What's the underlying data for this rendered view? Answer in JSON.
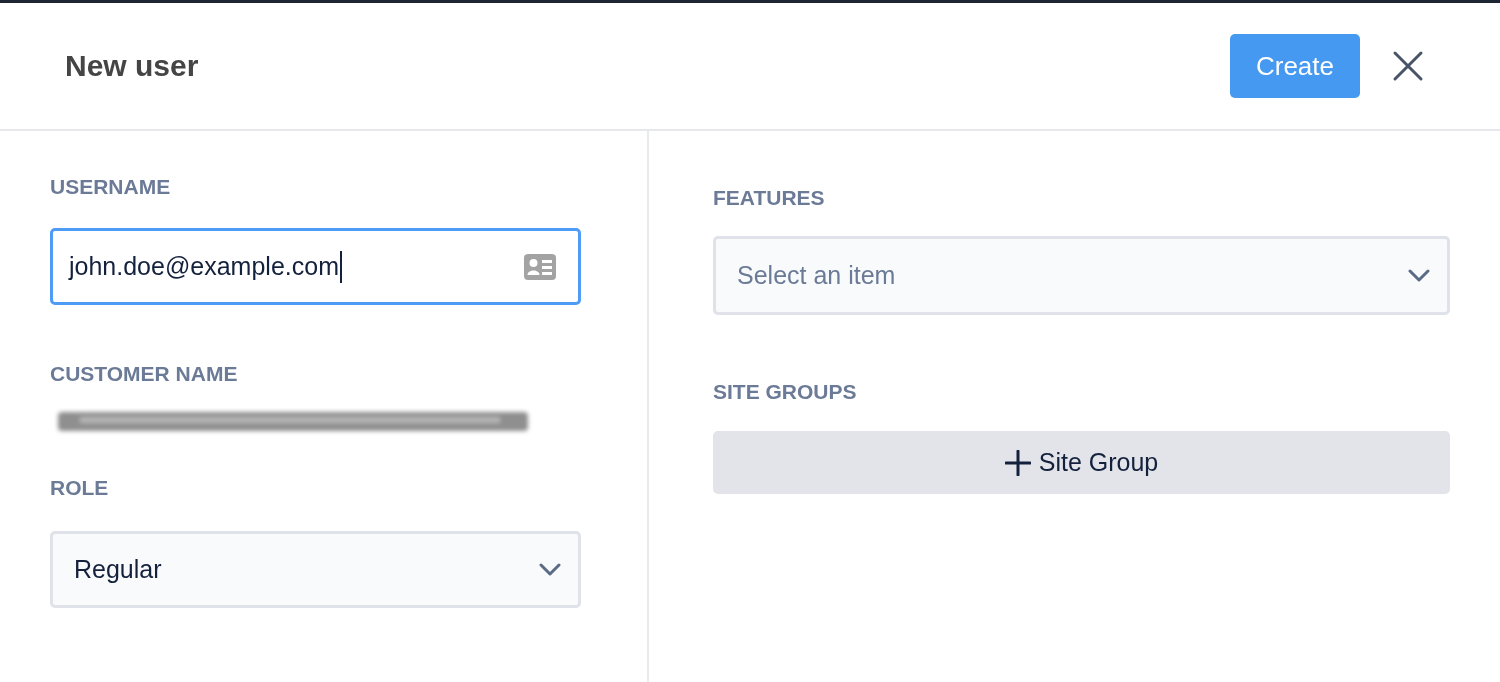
{
  "header": {
    "title": "New user",
    "create_button": "Create"
  },
  "left": {
    "username": {
      "label": "USERNAME",
      "value": "john.doe@example.com",
      "focused": true
    },
    "customer_name": {
      "label": "CUSTOMER NAME",
      "value_redacted": true
    },
    "role": {
      "label": "ROLE",
      "value": "Regular"
    }
  },
  "right": {
    "features": {
      "label": "FEATURES",
      "placeholder": "Select an item"
    },
    "site_groups": {
      "label": "SITE GROUPS",
      "add_button": "Site Group"
    }
  }
}
